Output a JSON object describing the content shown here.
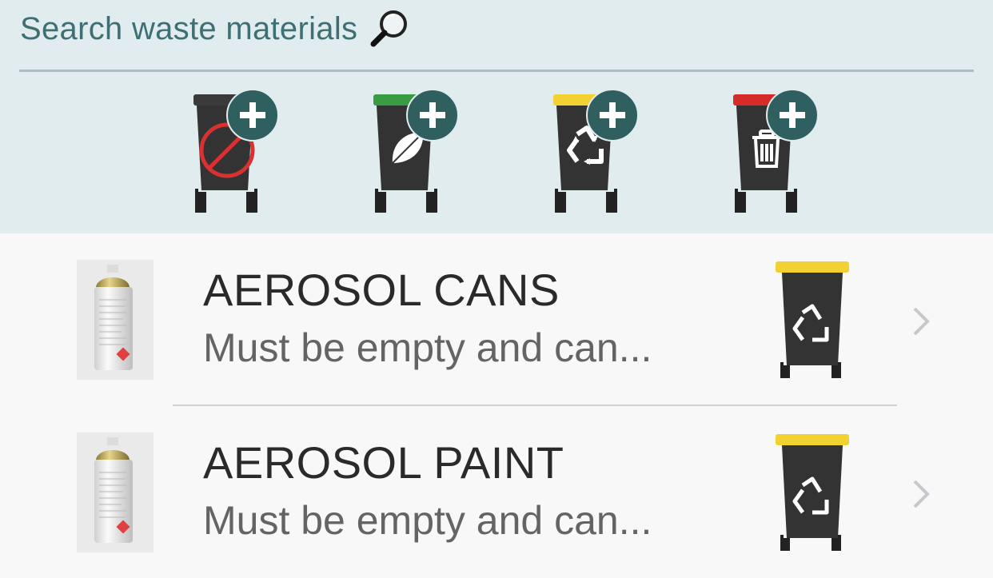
{
  "search": {
    "placeholder": "Search waste materials",
    "icon": "magnifying-glass"
  },
  "bin_filters": [
    {
      "id": "general",
      "lid_color": "#3a3a3a",
      "symbol": "no-symbol",
      "action_icon": "plus"
    },
    {
      "id": "garden",
      "lid_color": "#3a9b45",
      "symbol": "leaf",
      "action_icon": "plus"
    },
    {
      "id": "recycling",
      "lid_color": "#f2d232",
      "symbol": "recycle",
      "action_icon": "plus"
    },
    {
      "id": "landfill",
      "lid_color": "#d72a2a",
      "symbol": "trash-can",
      "action_icon": "plus"
    }
  ],
  "items": [
    {
      "title": "AEROSOL CANS",
      "description": "Must be empty and can...",
      "bin": "recycling",
      "bin_lid_color": "#f2d232"
    },
    {
      "title": "AEROSOL PAINT",
      "description": "Must be empty and can...",
      "bin": "recycling",
      "bin_lid_color": "#f2d232"
    }
  ],
  "colors": {
    "header_bg": "#e0ecee",
    "accent": "#3f6f72",
    "plus_badge": "#2f5f5e",
    "bin_body": "#333333"
  }
}
